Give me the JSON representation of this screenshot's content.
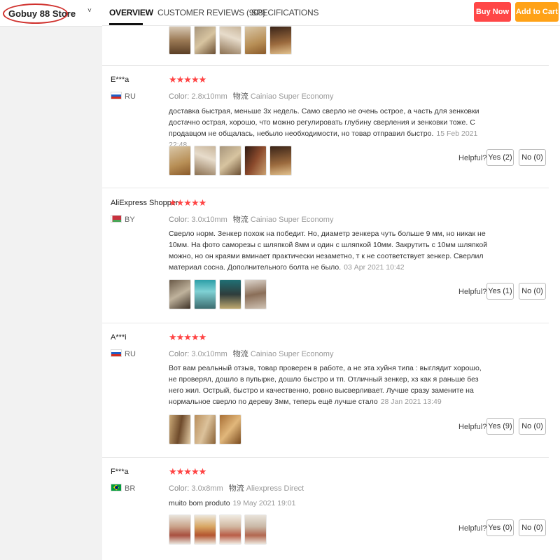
{
  "store": {
    "name": "Gobuy 88 Store",
    "chevron": "˅"
  },
  "nav": {
    "tabs": [
      {
        "label": "OVERVIEW"
      },
      {
        "label": "CUSTOMER REVIEWS (908)"
      },
      {
        "label": "SPECIFICATIONS"
      }
    ],
    "buy_now": "Buy Now",
    "add_to_cart": "Add to Cart"
  },
  "labels": {
    "color": "Color:",
    "logistics": "物流",
    "helpful": "Helpful?"
  },
  "reviews": [
    {
      "name": "E***a",
      "country": "RU",
      "stars": "★★★★★",
      "color": "2.8x10mm",
      "shipping": "Cainiao Super Economy",
      "text": "доставка быстрая, меньше 3х недель. Само сверло не очень острое, а часть для зенковки достачно острая, хорошо, что можно регулировать глубину сверления и зенковки тоже. С продавцом не общалась, небыло необходимости, но товар отправил быстро.",
      "date": "15 Feb 2021 22:48",
      "yes": "Yes (2)",
      "no": "No (0)"
    },
    {
      "name": "AliExpress Shopper",
      "country": "BY",
      "stars": "★★★★★",
      "color": "3.0x10mm",
      "shipping": "Cainiao Super Economy",
      "text": "Сверло норм. Зенкер похож на победит. Но, диаметр зенкера чуть больше 9 мм, но никак не 10мм. На фото саморезы с шляпкой 8мм и один с шляпкой 10мм. Закрутить с 10мм шляпкой можно, но он краями вминает практически незаметно, т к не соответствует зенкер. Сверлил материал сосна. Дополнительного болта не было.",
      "date": "03 Apr 2021 10:42",
      "yes": "Yes (1)",
      "no": "No (0)"
    },
    {
      "name": "A***i",
      "country": "RU",
      "stars": "★★★★★",
      "color": "3.0x10mm",
      "shipping": "Cainiao Super Economy",
      "text": "Вот вам реальный отзыв, товар проверен в работе, а не эта хуйня типа : выглядит хорошо, не проверял, дошло в пупырке, дошло быстро и тп. Отличный зенкер, хз как я раньше без него жил. Острый, быстро и качественно, ровно высверливает. Лучше сразу замените на нормальное сверло по дереву 3мм, теперь ещё лучше стало",
      "date": "28 Jan 2021 13:49",
      "yes": "Yes (9)",
      "no": "No (0)"
    },
    {
      "name": "F***a",
      "country": "BR",
      "stars": "★★★★★",
      "color": "3.0x8mm",
      "shipping": "Aliexpress Direct",
      "text": "muito bom produto",
      "date": "19 May 2021 19:01",
      "yes": "Yes (0)",
      "no": "No (0)"
    }
  ]
}
